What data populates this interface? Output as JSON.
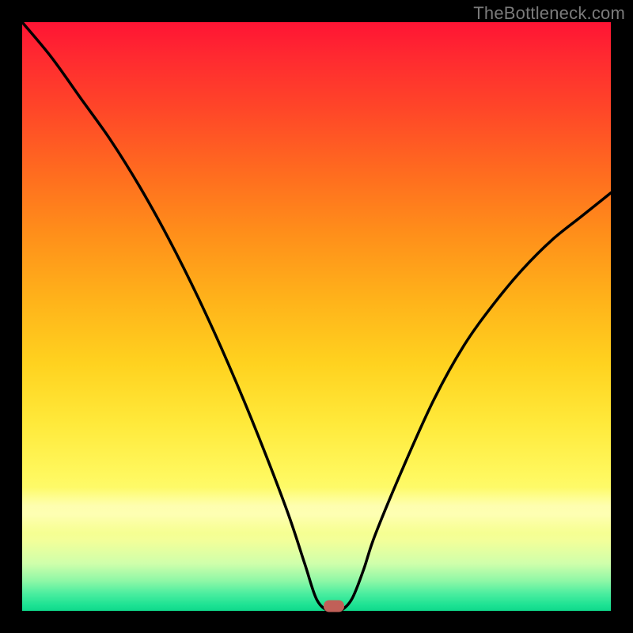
{
  "watermark": "TheBottleneck.com",
  "chart_data": {
    "type": "line",
    "title": "",
    "xlabel": "",
    "ylabel": "",
    "xlim": [
      0,
      100
    ],
    "ylim": [
      0,
      100
    ],
    "grid": false,
    "series": [
      {
        "name": "bottleneck-curve",
        "x": [
          0,
          5,
          10,
          15,
          20,
          25,
          30,
          35,
          40,
          45,
          48,
          50,
          52,
          54,
          56,
          58,
          60,
          65,
          70,
          75,
          80,
          85,
          90,
          95,
          100
        ],
        "values": [
          100,
          94,
          87,
          80,
          72,
          63,
          53,
          42,
          30,
          17,
          8,
          2,
          0,
          0,
          2,
          7,
          13,
          25,
          36,
          45,
          52,
          58,
          63,
          67,
          71
        ]
      }
    ],
    "marker": {
      "x": 53.0,
      "y": 0
    },
    "gradient_stops": [
      {
        "pos": 0,
        "color": "#ff1434"
      },
      {
        "pos": 50,
        "color": "#ffd21f"
      },
      {
        "pos": 85,
        "color": "#fdff7c"
      },
      {
        "pos": 100,
        "color": "#0fd98b"
      }
    ]
  }
}
